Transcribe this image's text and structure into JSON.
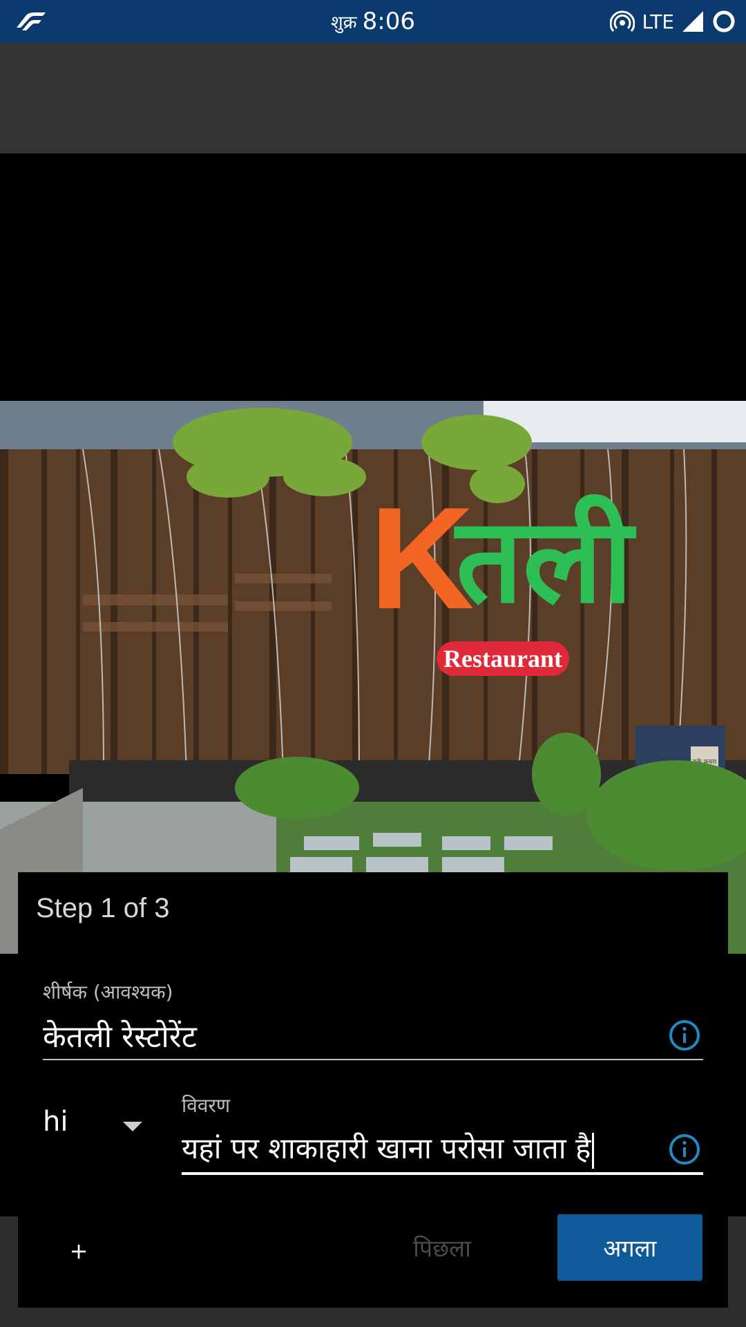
{
  "status_bar": {
    "day": "शुक्र",
    "time": "8:06",
    "network": "LTE"
  },
  "photo": {
    "sign_text_orange": "K",
    "sign_text_green": "तली",
    "sign_badge": "Restaurant",
    "bin_label": "सुके कचरा"
  },
  "dialog": {
    "step_label": "Step 1 of 3",
    "title_field": {
      "label": "शीर्षक (आवश्यक)",
      "value": "केतली रेस्टोरेंट"
    },
    "language": {
      "selected": "hi"
    },
    "description_field": {
      "label": "विवरण",
      "value": "यहां पर शाकाहारी खाना परोसा जाता है"
    },
    "add_button_label": "+",
    "previous_button_label": "पिछला",
    "next_button_label": "अगला"
  },
  "colors": {
    "status_bar": "#0a3a6e",
    "accent_button": "#0f5a9a",
    "info_icon": "#1e8cc4"
  }
}
